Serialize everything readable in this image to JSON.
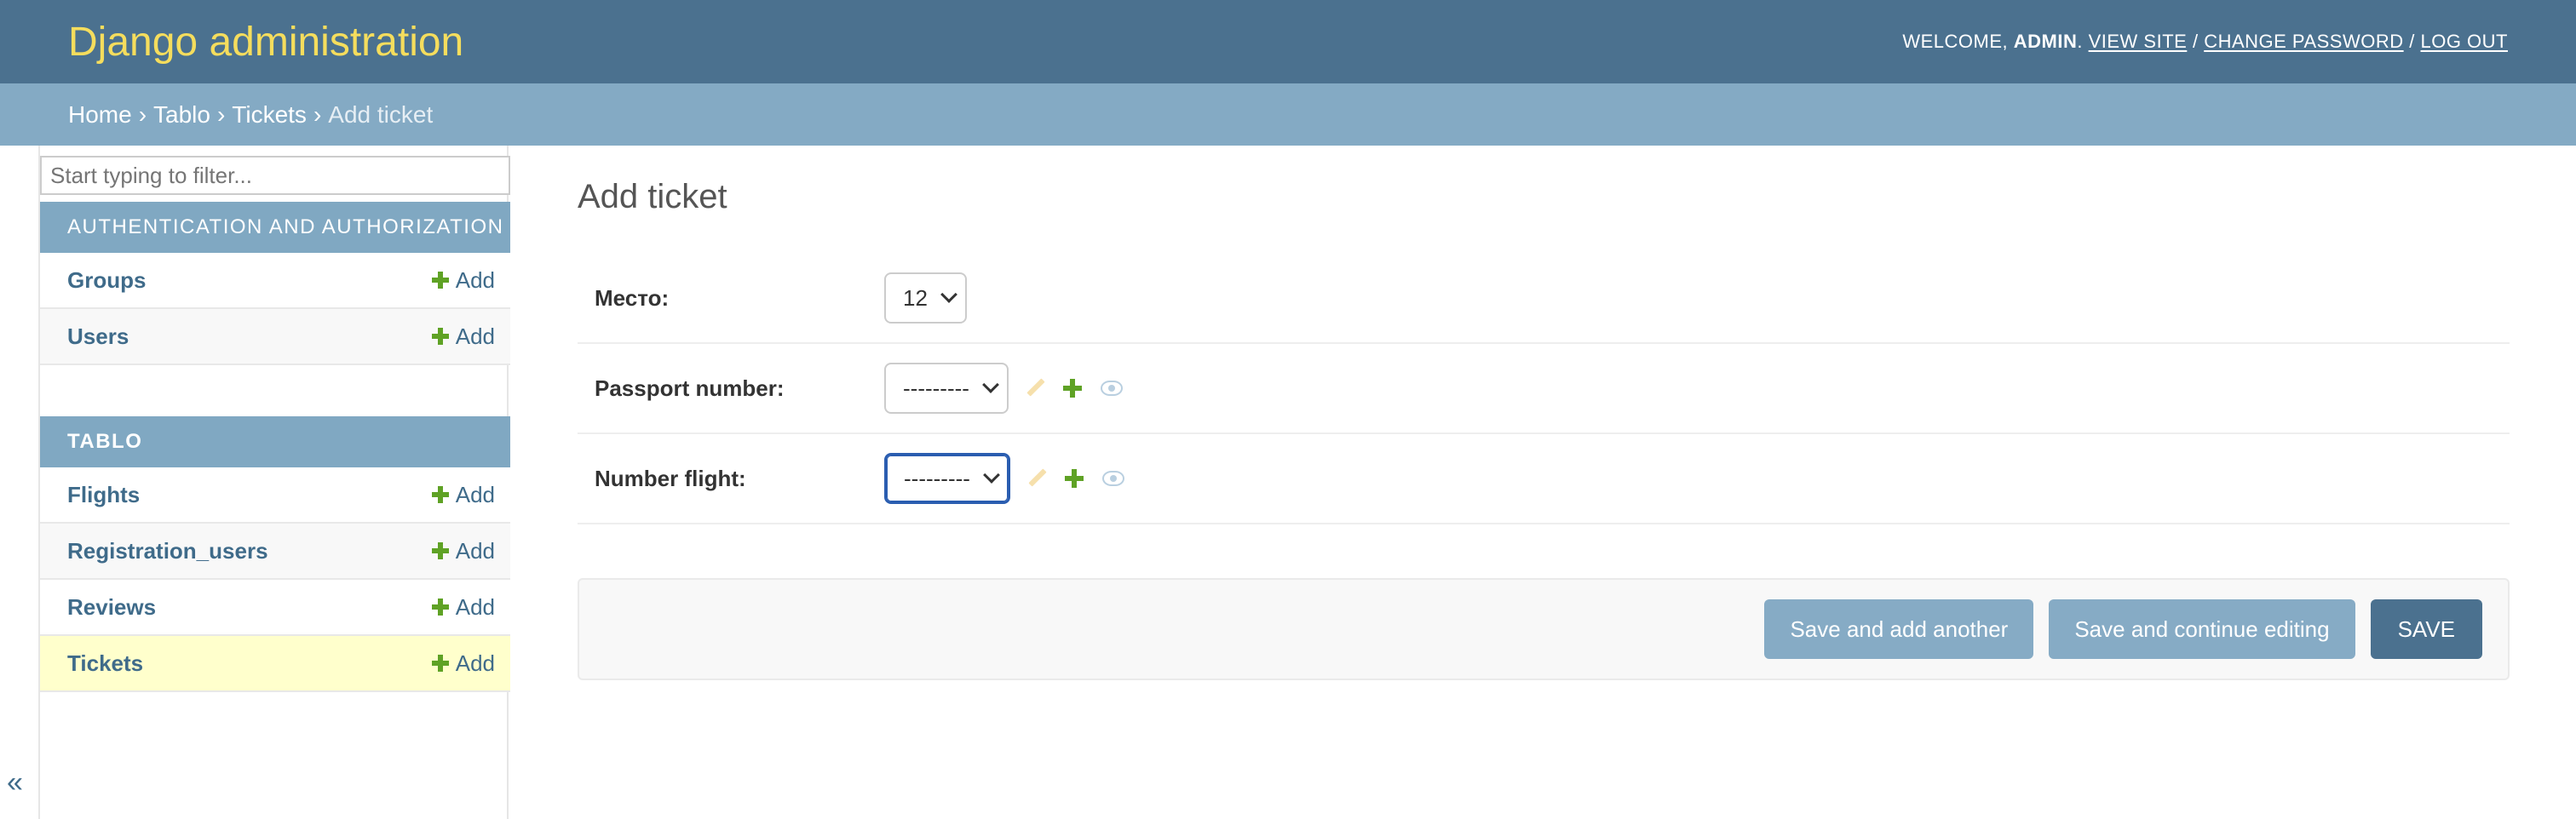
{
  "header": {
    "brand": "Django administration",
    "welcome": "WELCOME, ",
    "username": "ADMIN",
    "after_user": ". ",
    "view_site": "VIEW SITE",
    "sep1": " / ",
    "change_password": "CHANGE PASSWORD",
    "sep2": " / ",
    "log_out": "LOG OUT"
  },
  "breadcrumbs": {
    "home": "Home",
    "app": "Tablo",
    "model": "Tickets",
    "current": "Add ticket",
    "separator": "›"
  },
  "sidebar": {
    "filter_placeholder": "Start typing to filter...",
    "modules": [
      {
        "caption": "AUTHENTICATION AND AUTHORIZATION",
        "models": [
          {
            "name": "Groups",
            "add": "Add"
          },
          {
            "name": "Users",
            "add": "Add"
          }
        ]
      },
      {
        "caption": "TABLO",
        "models": [
          {
            "name": "Flights",
            "add": "Add"
          },
          {
            "name": "Registration_users",
            "add": "Add"
          },
          {
            "name": "Reviews",
            "add": "Add"
          },
          {
            "name": "Tickets",
            "add": "Add"
          }
        ]
      }
    ],
    "toggle": "«"
  },
  "main": {
    "title": "Add ticket",
    "fields": [
      {
        "label": "Место:",
        "value": "12"
      },
      {
        "label": "Passport number:",
        "value": "---------"
      },
      {
        "label": "Number flight:",
        "value": "---------"
      }
    ],
    "buttons": {
      "save_add_another": "Save and add another",
      "save_continue": "Save and continue editing",
      "save": "SAVE"
    }
  },
  "colors": {
    "header_bg": "#4b718f",
    "breadcrumb_bg": "#84aac4",
    "brand": "#f5dd5d",
    "link": "#3f6b8a",
    "add_green": "#5fa225",
    "current_row": "#ffffcc"
  },
  "icons": [
    "pencil-icon",
    "plus-icon",
    "eye-icon",
    "chevron-down-icon",
    "collapse-sidebar-icon"
  ]
}
